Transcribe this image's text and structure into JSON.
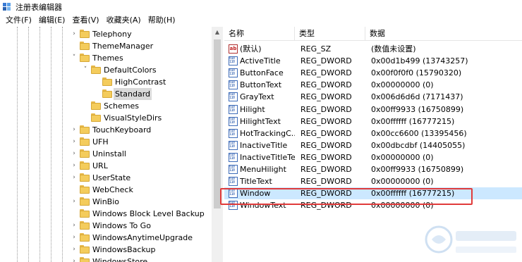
{
  "window": {
    "title": "注册表编辑器"
  },
  "menu": [
    {
      "label": "文件(F)"
    },
    {
      "label": "编辑(E)"
    },
    {
      "label": "查看(V)"
    },
    {
      "label": "收藏夹(A)"
    },
    {
      "label": "帮助(H)"
    }
  ],
  "tree": {
    "items": [
      {
        "label": "Telephony",
        "expander": "›",
        "selected": false
      },
      {
        "label": "ThemeManager",
        "expander": "",
        "selected": false
      },
      {
        "label": "Themes",
        "expander": "˅",
        "selected": false
      },
      {
        "label": "DefaultColors",
        "expander": "˅",
        "selected": false
      },
      {
        "label": "HighContrast",
        "expander": "",
        "selected": false
      },
      {
        "label": "Standard",
        "expander": "",
        "selected": true
      },
      {
        "label": "Schemes",
        "expander": "",
        "selected": false
      },
      {
        "label": "VisualStyleDirs",
        "expander": "",
        "selected": false
      },
      {
        "label": "TouchKeyboard",
        "expander": "›",
        "selected": false
      },
      {
        "label": "UFH",
        "expander": "›",
        "selected": false
      },
      {
        "label": "Uninstall",
        "expander": "›",
        "selected": false
      },
      {
        "label": "URL",
        "expander": "›",
        "selected": false
      },
      {
        "label": "UserState",
        "expander": "›",
        "selected": false
      },
      {
        "label": "WebCheck",
        "expander": "",
        "selected": false
      },
      {
        "label": "WinBio",
        "expander": "›",
        "selected": false
      },
      {
        "label": "Windows Block Level Backup",
        "expander": "",
        "selected": false
      },
      {
        "label": "Windows To Go",
        "expander": "›",
        "selected": false
      },
      {
        "label": "WindowsAnytimeUpgrade",
        "expander": "›",
        "selected": false
      },
      {
        "label": "WindowsBackup",
        "expander": "›",
        "selected": false
      },
      {
        "label": "WindowsStore",
        "expander": "›",
        "selected": false
      }
    ]
  },
  "list": {
    "headers": {
      "name": "名称",
      "type": "类型",
      "data": "数据"
    },
    "rows": [
      {
        "name": "(默认)",
        "type": "REG_SZ",
        "data": "(数值未设置)",
        "icon": "string-value-icon"
      },
      {
        "name": "ActiveTitle",
        "type": "REG_DWORD",
        "data": "0x00d1b499 (13743257)",
        "icon": "binary-value-icon"
      },
      {
        "name": "ButtonFace",
        "type": "REG_DWORD",
        "data": "0x00f0f0f0 (15790320)",
        "icon": "binary-value-icon"
      },
      {
        "name": "ButtonText",
        "type": "REG_DWORD",
        "data": "0x00000000 (0)",
        "icon": "binary-value-icon"
      },
      {
        "name": "GrayText",
        "type": "REG_DWORD",
        "data": "0x006d6d6d (7171437)",
        "icon": "binary-value-icon"
      },
      {
        "name": "Hilight",
        "type": "REG_DWORD",
        "data": "0x00ff9933 (16750899)",
        "icon": "binary-value-icon"
      },
      {
        "name": "HilightText",
        "type": "REG_DWORD",
        "data": "0x00ffffff (16777215)",
        "icon": "binary-value-icon"
      },
      {
        "name": "HotTrackingC...",
        "type": "REG_DWORD",
        "data": "0x00cc6600 (13395456)",
        "icon": "binary-value-icon"
      },
      {
        "name": "InactiveTitle",
        "type": "REG_DWORD",
        "data": "0x00dbcdbf (14405055)",
        "icon": "binary-value-icon"
      },
      {
        "name": "InactiveTitleText",
        "type": "REG_DWORD",
        "data": "0x00000000 (0)",
        "icon": "binary-value-icon"
      },
      {
        "name": "MenuHilight",
        "type": "REG_DWORD",
        "data": "0x00ff9933 (16750899)",
        "icon": "binary-value-icon"
      },
      {
        "name": "TitleText",
        "type": "REG_DWORD",
        "data": "0x00000000 (0)",
        "icon": "binary-value-icon"
      },
      {
        "name": "Window",
        "type": "REG_DWORD",
        "data": "0x00ffffff (16777215)",
        "icon": "binary-value-icon"
      },
      {
        "name": "WindowText",
        "type": "REG_DWORD",
        "data": "0x00000000 (0)",
        "icon": "binary-value-icon"
      }
    ],
    "highlighted_row": "Window"
  },
  "colors": {
    "highlight_box": "#e03b3b",
    "row_highlight": "#cce8ff",
    "folder": "#f4cc5c"
  }
}
